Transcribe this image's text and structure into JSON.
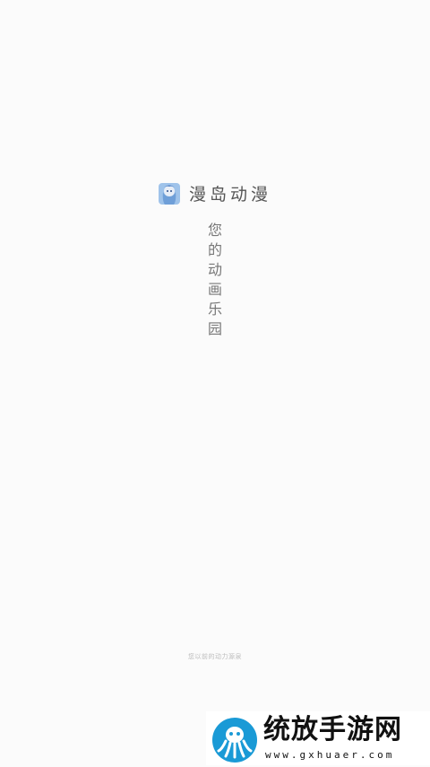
{
  "app": {
    "name": "漫岛动漫",
    "icon": "anime-girl-app-icon"
  },
  "tagline": [
    "您",
    "的",
    "动",
    "画",
    "乐",
    "园"
  ],
  "footer": {
    "text": "您以前的动力源泉"
  },
  "watermark": {
    "title": "统放手游网",
    "url": "www.gxhuaer.com",
    "logo": "octopus-logo",
    "logo_color": "#1a9ad6"
  }
}
